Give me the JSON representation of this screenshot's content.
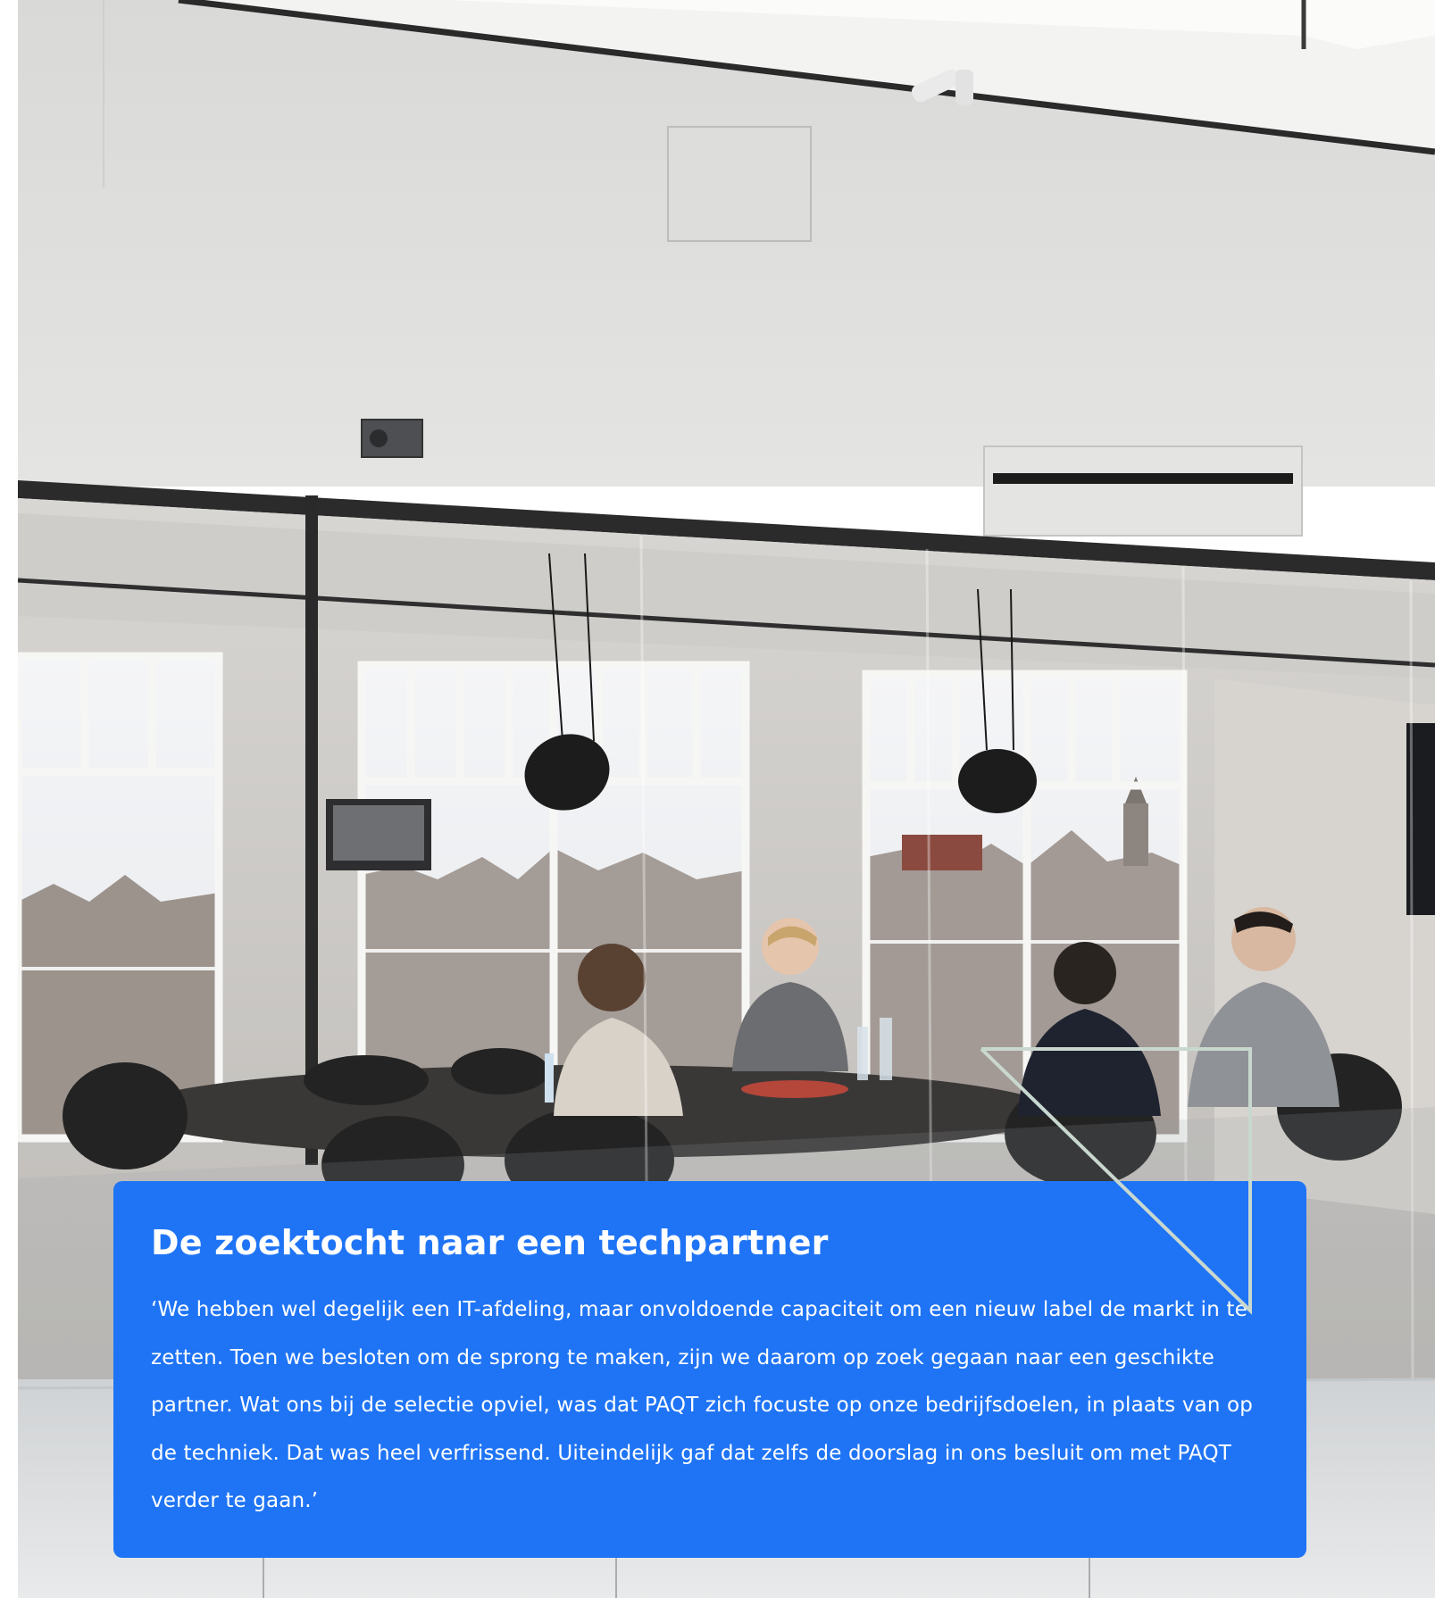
{
  "quote_card": {
    "title": "De zoektocht naar een techpartner",
    "text": "‘We hebben wel degelijk een IT-afdeling, maar onvoldoende capaciteit om een nieuw label de markt in te zetten. Toen we besloten om de sprong te maken, zijn we daarom op zoek gegaan naar een geschikte partner. Wat ons bij de selectie opviel, was dat PAQT zich focuste op onze bedrijfsdoelen, in plaats van op de techniek. Dat was heel verfrissend. Uiteindelijk gaf dat zelfs de doorslag in ons besluit om met PAQT verder te gaan.’"
  },
  "colors": {
    "card_background": "#1f74f5",
    "card_text": "#ffffff",
    "accent_line": "#c9d8cf",
    "wall": "#dcdcda",
    "ceiling": "#f2f2f0"
  },
  "icons": {
    "photo": "office-meeting-room-photo",
    "accent": "triangle-outline-accent"
  }
}
